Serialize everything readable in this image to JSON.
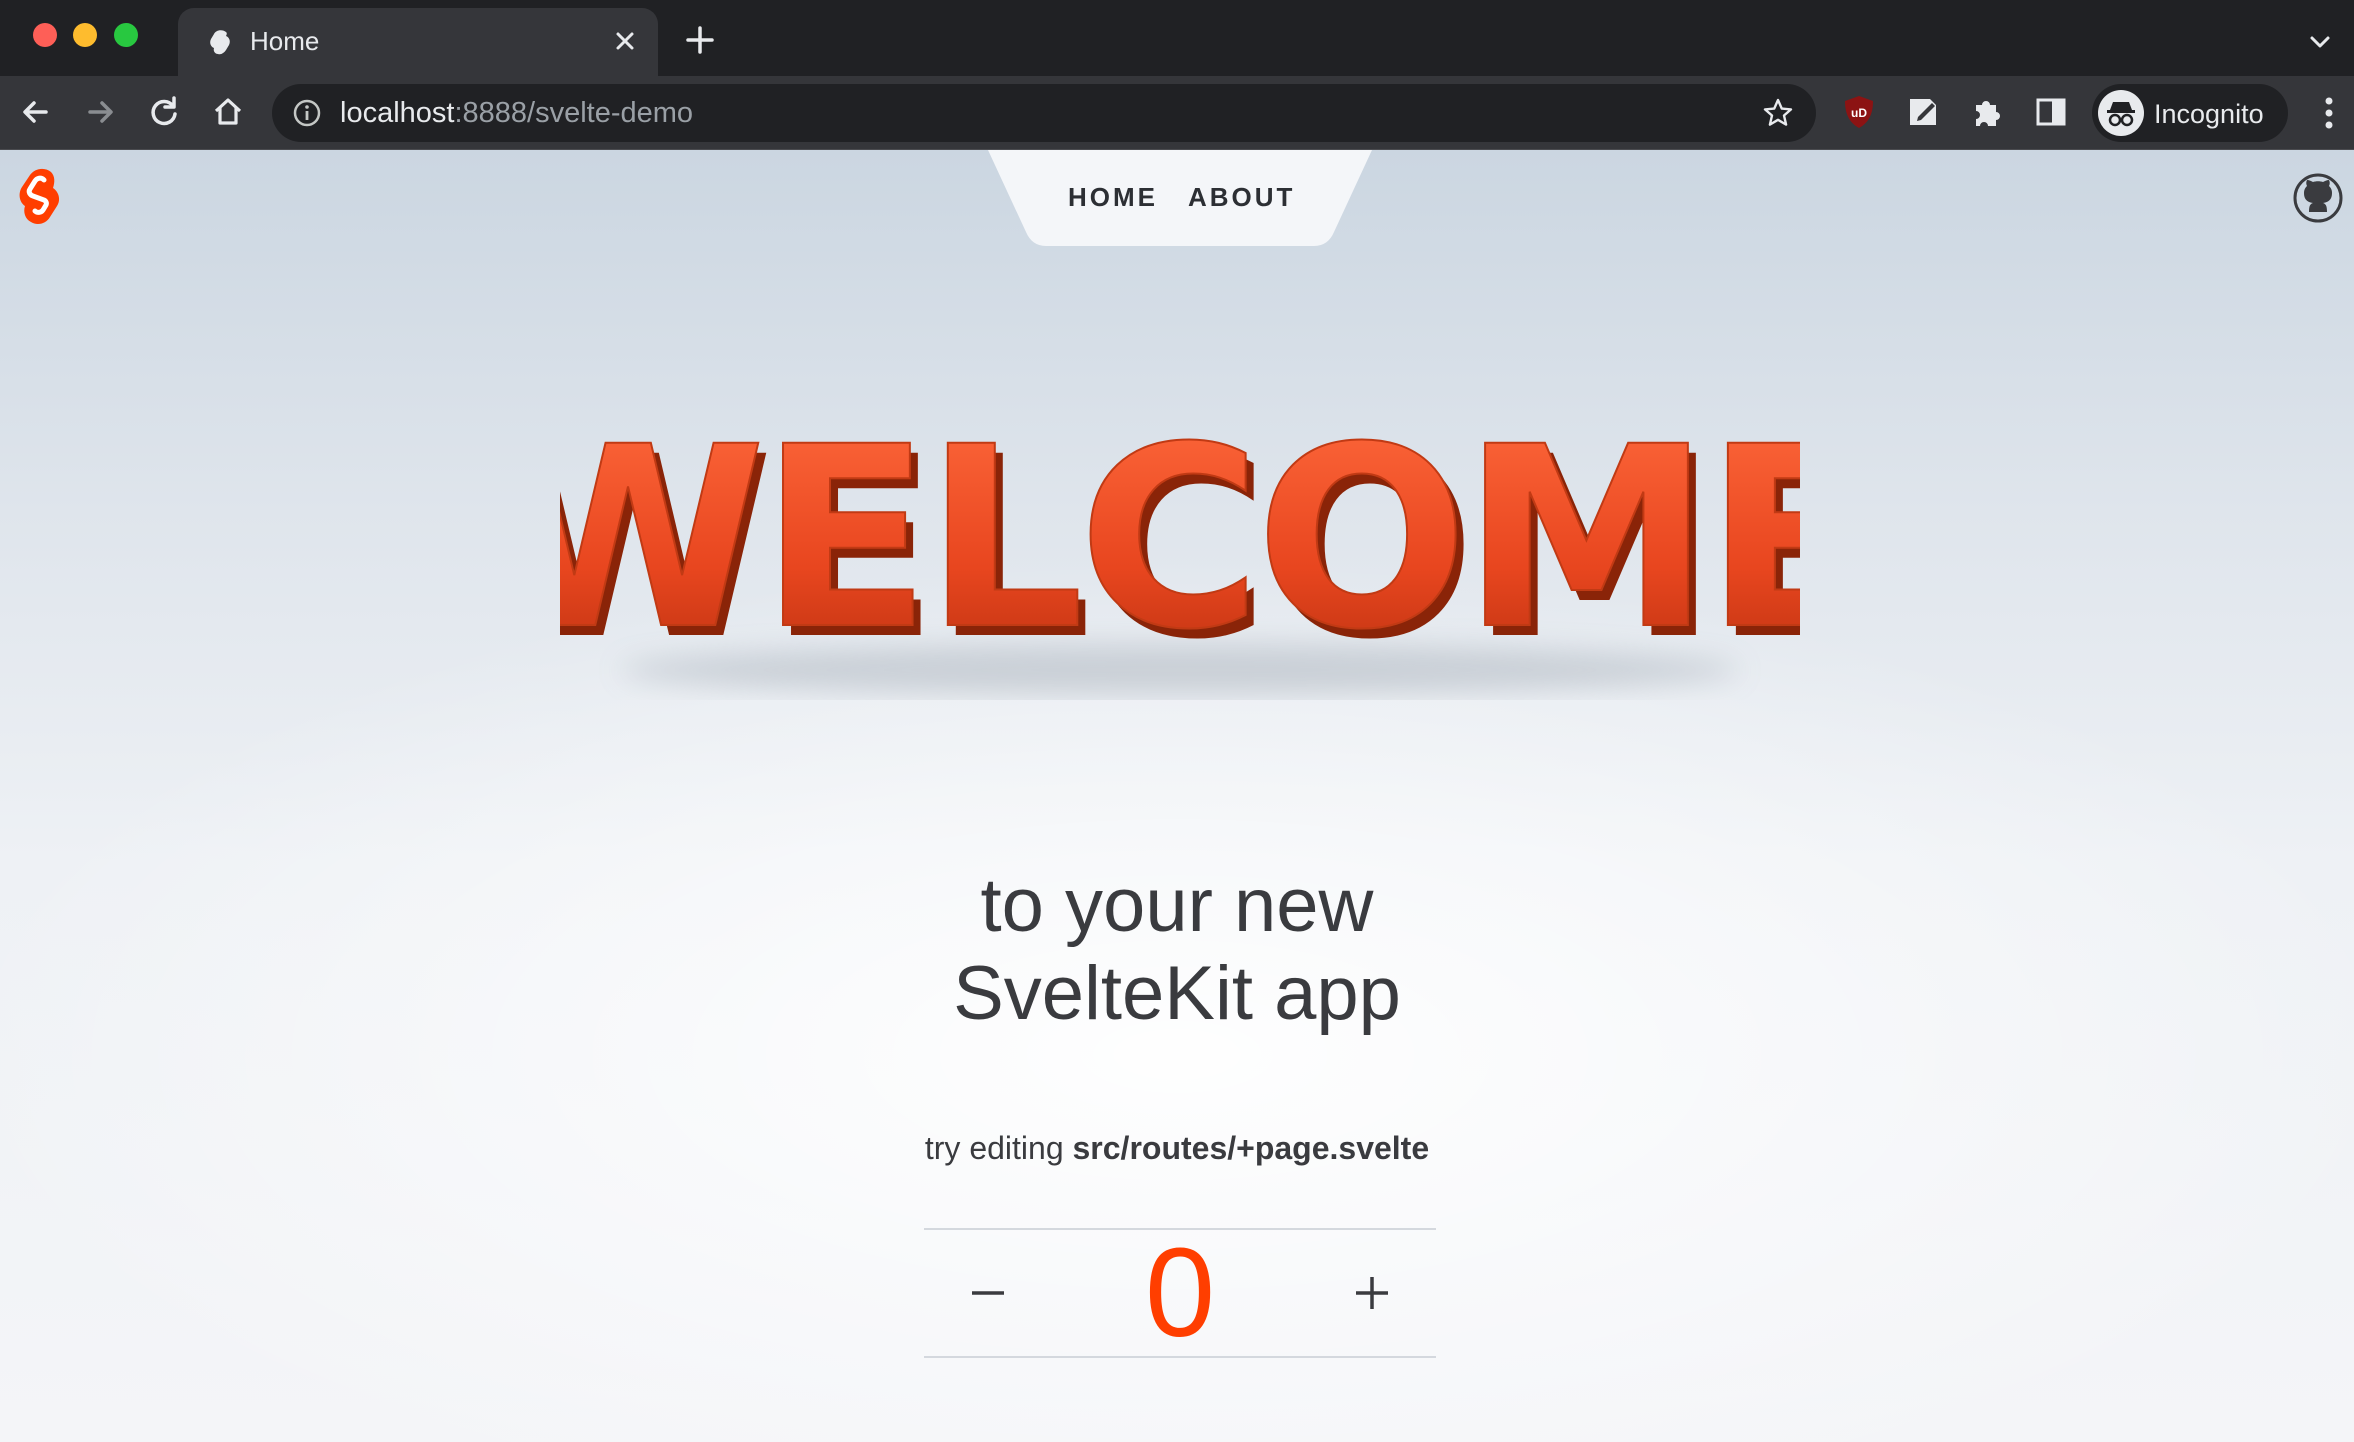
{
  "browser": {
    "tab": {
      "title": "Home"
    },
    "address": {
      "host": "localhost",
      "rest": ":8888/svelte-demo"
    },
    "profile": {
      "label": "Incognito"
    }
  },
  "nav": {
    "items": [
      {
        "label": "HOME"
      },
      {
        "label": "ABOUT"
      }
    ]
  },
  "hero": {
    "welcome_text": "WELCOME",
    "line1": "to your new",
    "line2": "SvelteKit app"
  },
  "hint": {
    "prefix": "try editing ",
    "path": "src/routes/+page.svelte"
  },
  "counter": {
    "value": "0",
    "minus_symbol": "–",
    "plus_symbol": "+"
  },
  "colors": {
    "accent": "#ff3e00",
    "chrome_dark": "#202124",
    "chrome_toolbar": "#35363a",
    "text": "#3a3b3f"
  },
  "icons": [
    "svelte-favicon",
    "close-icon",
    "plus-icon",
    "chevron-down-icon",
    "back-arrow-icon",
    "forward-arrow-icon",
    "reload-icon",
    "home-icon",
    "info-icon",
    "star-icon",
    "ublock-icon",
    "note-icon",
    "puzzle-icon",
    "sidepanel-icon",
    "incognito-icon",
    "kebab-icon",
    "svelte-logo-icon",
    "github-icon"
  ]
}
